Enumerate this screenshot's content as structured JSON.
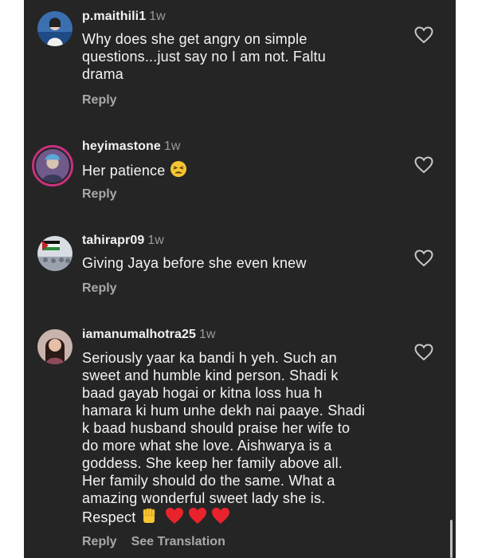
{
  "comments": [
    {
      "username": "p.maithili1",
      "time": "1w",
      "lines": [
        "Why does she get angry on simple",
        "questions...just say no I am not. Faltu",
        "drama"
      ],
      "reply_label": "Reply"
    },
    {
      "username": "heyimastone",
      "time": "1w",
      "lines": [
        "Her patience"
      ],
      "emoji_icon": "tired-face-emoji-icon",
      "reply_label": "Reply"
    },
    {
      "username": "tahirapr09",
      "time": "1w",
      "lines": [
        "Giving Jaya before she even knew"
      ],
      "reply_label": "Reply"
    },
    {
      "username": "iamanumalhotra25",
      "time": "1w",
      "lines": [
        "Seriously yaar ka bandi h yeh. Such an",
        "sweet and humble kind person. Shadi k",
        "baad gayab hogai or kitna loss hua h",
        "hamara ki hum unhe dekh nai paaye. Shadi",
        "k baad husband should praise her wife to",
        "do more what she love. Aishwarya is a",
        "goddess. She keep her family above all.",
        "Her family should do the same. What a",
        "amazing wonderful sweet lady she is.",
        "Respect"
      ],
      "emoji_icons": [
        "raised-fist-emoji-icon",
        "red-heart-emoji-icon",
        "red-heart-emoji-icon",
        "red-heart-emoji-icon"
      ],
      "reply_label": "Reply",
      "see_translation_label": "See Translation"
    }
  ],
  "colors": {
    "background": "#252525",
    "username": "#f2f2f2",
    "meta": "#9a9a9a",
    "heart_outline": "#c8c8c8"
  }
}
